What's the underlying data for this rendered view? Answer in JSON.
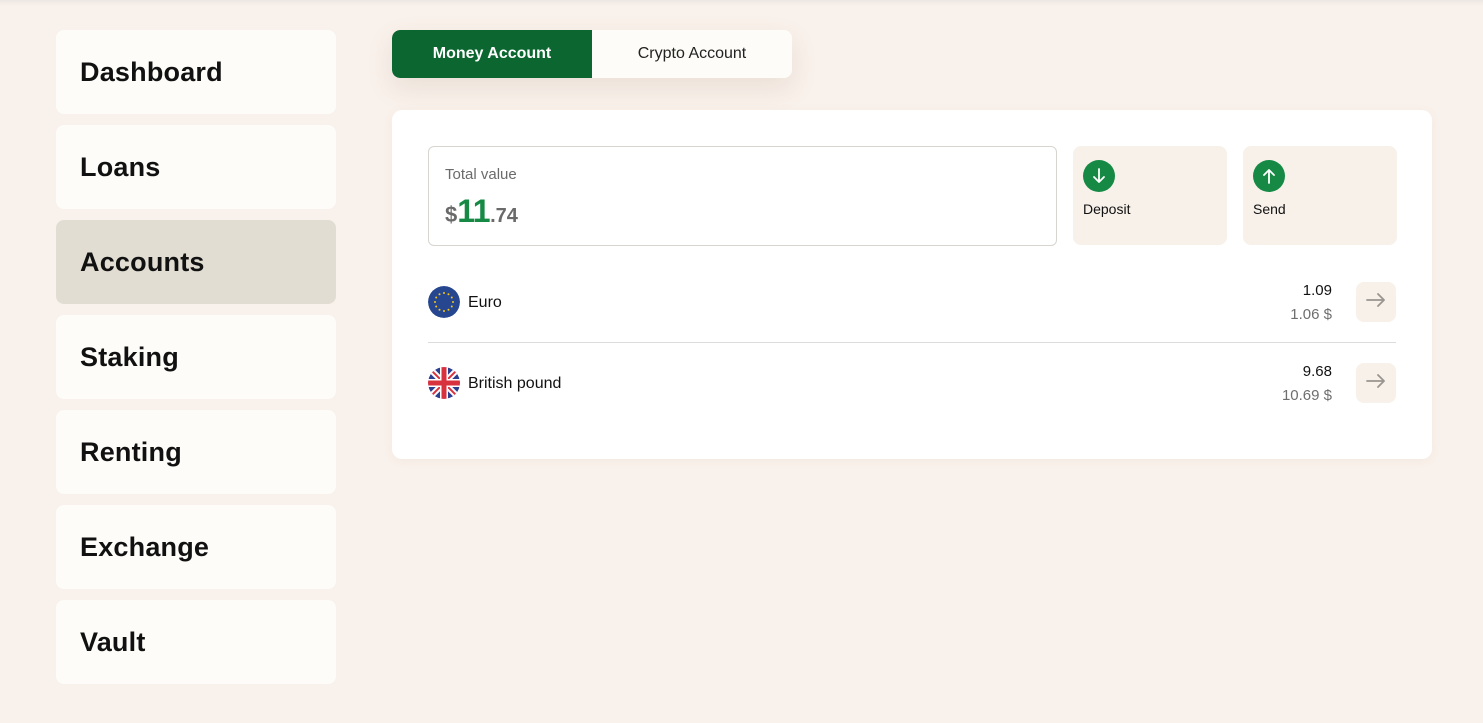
{
  "sidebar": {
    "items": [
      {
        "label": "Dashboard"
      },
      {
        "label": "Loans"
      },
      {
        "label": "Accounts"
      },
      {
        "label": "Staking"
      },
      {
        "label": "Renting"
      },
      {
        "label": "Exchange"
      },
      {
        "label": "Vault"
      }
    ],
    "active": "Accounts"
  },
  "account_toggle": {
    "money_label": "Money Account",
    "crypto_label": "Crypto Account",
    "selected": "Money Account"
  },
  "total": {
    "label": "Total value",
    "currency": "$",
    "integer": "11",
    "decimal": ".74"
  },
  "actions": {
    "deposit_label": "Deposit",
    "send_label": "Send"
  },
  "currencies": [
    {
      "name": "Euro",
      "amount": "1.09",
      "usd": "1.06 $",
      "flag": "eu-flag-icon"
    },
    {
      "name": "British pound",
      "amount": "9.68",
      "usd": "10.69 $",
      "flag": "uk-flag-icon"
    }
  ],
  "colors": {
    "background": "#f9f1eb",
    "accent_green": "#0c6630",
    "value_green": "#168a45",
    "active_nav": "#e1ddd2"
  }
}
